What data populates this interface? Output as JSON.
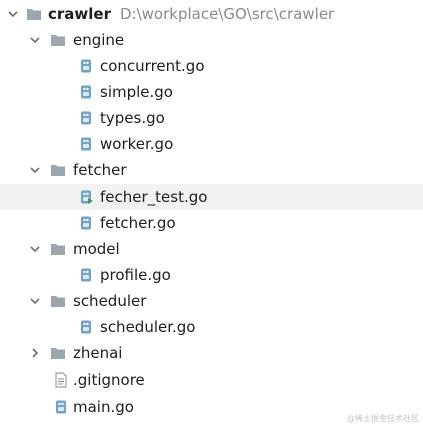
{
  "tree": {
    "root": {
      "name": "crawler",
      "path": "D:\\workplace\\GO\\src\\crawler"
    },
    "engine": {
      "name": "engine",
      "files": [
        "concurrent.go",
        "simple.go",
        "types.go",
        "worker.go"
      ]
    },
    "fetcher": {
      "name": "fetcher",
      "files": [
        "fecher_test.go",
        "fetcher.go"
      ]
    },
    "model": {
      "name": "model",
      "files": [
        "profile.go"
      ]
    },
    "scheduler": {
      "name": "scheduler",
      "files": [
        "scheduler.go"
      ]
    },
    "zhenai": {
      "name": "zhenai"
    },
    "root_files": [
      ".gitignore",
      "main.go"
    ]
  },
  "icons": {
    "folder": "folder-icon",
    "go_file": "go-file-icon",
    "go_test_file": "go-test-file-icon",
    "text_file": "text-file-icon",
    "expanded": "chevron-down-icon",
    "collapsed": "chevron-right-icon"
  },
  "colors": {
    "folder": "#9aa7b0",
    "go_file": "#6fa3c7",
    "path_text": "#8a8a8a",
    "selection": "#f2f2f2"
  },
  "watermark": "@稀土掘金技术社区"
}
